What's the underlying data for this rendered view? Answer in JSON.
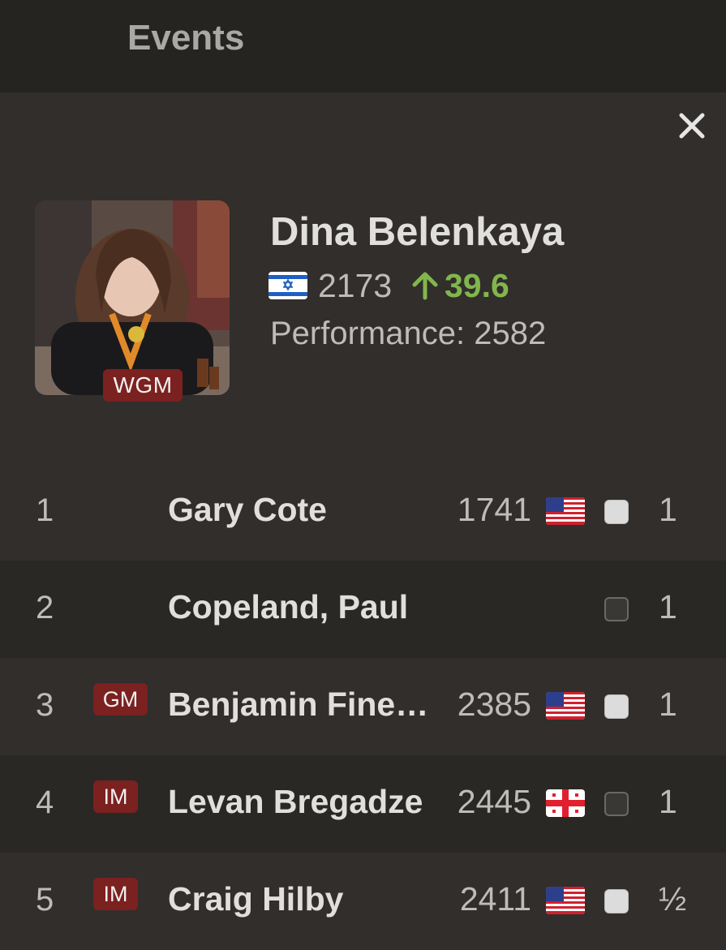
{
  "header": {
    "title": "Events"
  },
  "player": {
    "name": "Dina Belenkaya",
    "title": "WGM",
    "flag": "israel-flag",
    "rating": "2173",
    "change": "39.6",
    "performance": "Performance: 2582"
  },
  "games": [
    {
      "num": "1",
      "title": "",
      "name": "Gary Cote",
      "rating": "1741",
      "flag": "usa-flag",
      "color": "white",
      "result": "1"
    },
    {
      "num": "2",
      "title": "",
      "name": "Copeland, Paul",
      "rating": "",
      "flag": "",
      "color": "black",
      "result": "1"
    },
    {
      "num": "3",
      "title": "GM",
      "name": "Benjamin Fine…",
      "rating": "2385",
      "flag": "usa-flag",
      "color": "white",
      "result": "1"
    },
    {
      "num": "4",
      "title": "IM",
      "name": "Levan Bregadze",
      "rating": "2445",
      "flag": "georgia-flag",
      "color": "black",
      "result": "1"
    },
    {
      "num": "5",
      "title": "IM",
      "name": "Craig Hilby",
      "rating": "2411",
      "flag": "usa-flag",
      "color": "white",
      "result": "½"
    }
  ],
  "colors": {
    "accent_gain": "#81b64c",
    "title_badge": "#7b2120",
    "background": "#312e2b"
  }
}
